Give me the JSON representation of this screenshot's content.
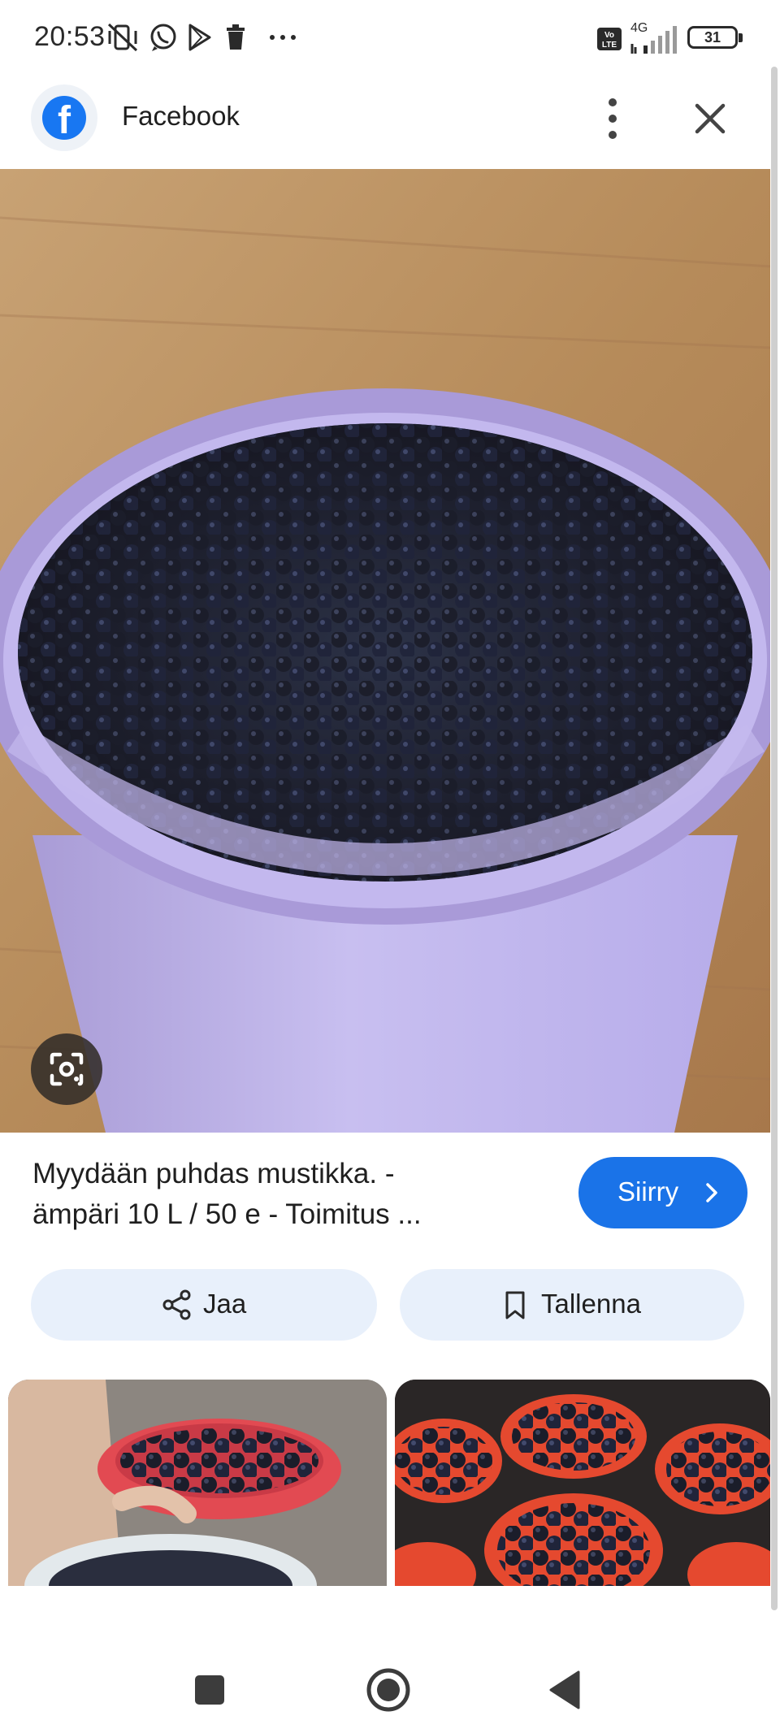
{
  "status_bar": {
    "time": "20:53",
    "network": "4G",
    "battery": "31",
    "icons": [
      "mute-vibrate-icon",
      "whatsapp-icon",
      "play-store-icon",
      "trash-icon",
      "more-notifications-icon",
      "volte-icon",
      "signal-icon",
      "battery-icon"
    ]
  },
  "header": {
    "source_title": "Facebook",
    "logo_icon": "facebook-logo",
    "more_icon": "more-vert-icon",
    "close_icon": "close-icon"
  },
  "image": {
    "description_icon": "lens-icon"
  },
  "caption": {
    "line1": "Myydään puhdas mustikka. -",
    "line2": "ämpäri 10 L / 50 e - Toimitus ..."
  },
  "visit_button": {
    "label": "Siirry"
  },
  "actions": {
    "share_label": "Jaa",
    "save_label": "Tallenna"
  },
  "colors": {
    "accent": "#1a73e8",
    "action_bg": "#e8f0fb",
    "facebook_blue": "#1877f2"
  }
}
